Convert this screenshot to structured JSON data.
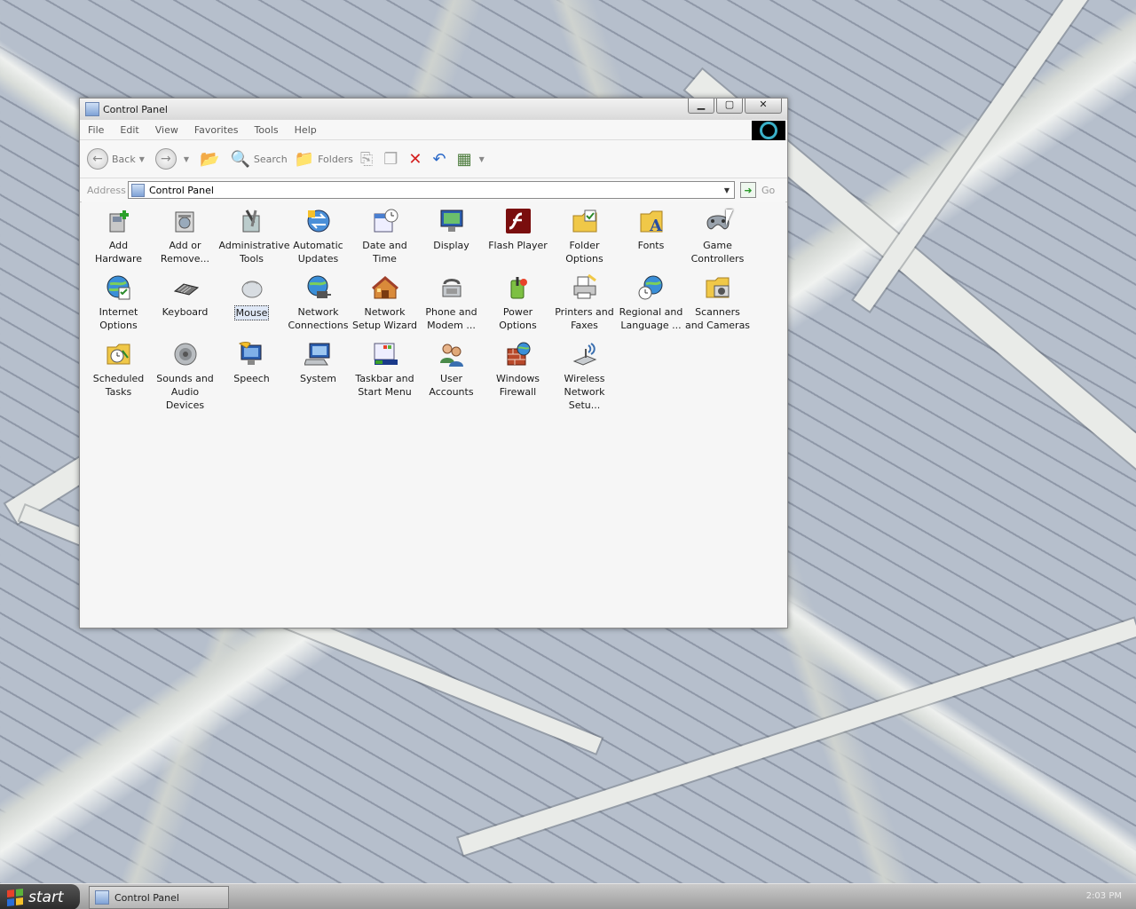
{
  "window": {
    "title": "Control Panel",
    "controls": {
      "minimize": "▁",
      "maximize": "▢",
      "close": "✕"
    }
  },
  "menu": [
    "File",
    "Edit",
    "View",
    "Favorites",
    "Tools",
    "Help"
  ],
  "toolbar": {
    "back": "Back",
    "search": "Search",
    "folders": "Folders"
  },
  "address": {
    "label": "Address",
    "value": "Control Panel",
    "go": "Go"
  },
  "items": [
    {
      "label": "Add Hardware",
      "icon": "add-hardware-icon"
    },
    {
      "label": "Add or Remove...",
      "icon": "add-remove-icon"
    },
    {
      "label": "Administrative Tools",
      "icon": "admin-tools-icon"
    },
    {
      "label": "Automatic Updates",
      "icon": "automatic-updates-icon"
    },
    {
      "label": "Date and Time",
      "icon": "date-time-icon"
    },
    {
      "label": "Display",
      "icon": "display-icon"
    },
    {
      "label": "Flash Player",
      "icon": "flash-player-icon"
    },
    {
      "label": "Folder Options",
      "icon": "folder-options-icon"
    },
    {
      "label": "Fonts",
      "icon": "fonts-icon"
    },
    {
      "label": "Game Controllers",
      "icon": "game-controllers-icon"
    },
    {
      "label": "Internet Options",
      "icon": "internet-options-icon"
    },
    {
      "label": "Keyboard",
      "icon": "keyboard-icon"
    },
    {
      "label": "Mouse",
      "icon": "mouse-icon"
    },
    {
      "label": "Network Connections",
      "icon": "network-connections-icon"
    },
    {
      "label": "Network Setup Wizard",
      "icon": "network-setup-icon"
    },
    {
      "label": "Phone and Modem ...",
      "icon": "phone-modem-icon"
    },
    {
      "label": "Power Options",
      "icon": "power-options-icon"
    },
    {
      "label": "Printers and Faxes",
      "icon": "printers-faxes-icon"
    },
    {
      "label": "Regional and Language ...",
      "icon": "regional-language-icon"
    },
    {
      "label": "Scanners and Cameras",
      "icon": "scanners-cameras-icon"
    },
    {
      "label": "Scheduled Tasks",
      "icon": "scheduled-tasks-icon"
    },
    {
      "label": "Sounds and Audio Devices",
      "icon": "sounds-audio-icon"
    },
    {
      "label": "Speech",
      "icon": "speech-icon"
    },
    {
      "label": "System",
      "icon": "system-icon"
    },
    {
      "label": "Taskbar and Start Menu",
      "icon": "taskbar-start-icon"
    },
    {
      "label": "User Accounts",
      "icon": "user-accounts-icon"
    },
    {
      "label": "Windows Firewall",
      "icon": "windows-firewall-icon"
    },
    {
      "label": "Wireless Network Setu...",
      "icon": "wireless-network-icon"
    }
  ],
  "selected_item": "Mouse",
  "taskbar": {
    "start": "start",
    "task": "Control Panel",
    "clock": "2:03 PM"
  }
}
